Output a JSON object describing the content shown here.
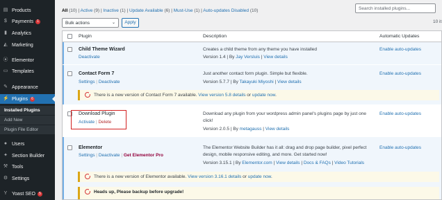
{
  "sidebar": {
    "items": [
      {
        "label": "Products",
        "icon": "products-icon"
      },
      {
        "label": "Payments",
        "icon": "payments-icon",
        "badge": "1"
      },
      {
        "label": "Analytics",
        "icon": "analytics-icon"
      },
      {
        "label": "Marketing",
        "icon": "marketing-icon"
      },
      {
        "label": "Elementor",
        "icon": "elementor-icon"
      },
      {
        "label": "Templates",
        "icon": "templates-icon"
      },
      {
        "label": "Appearance",
        "icon": "appearance-icon"
      },
      {
        "label": "Plugins",
        "icon": "plugins-icon",
        "badge": "6"
      },
      {
        "label": "Users",
        "icon": "users-icon"
      },
      {
        "label": "Section Builder",
        "icon": "section-builder-icon"
      },
      {
        "label": "Tools",
        "icon": "tools-icon"
      },
      {
        "label": "Settings",
        "icon": "settings-icon"
      },
      {
        "label": "Yoast SEO",
        "icon": "yoast-icon",
        "badge": "5"
      }
    ],
    "submenu": [
      "Installed Plugins",
      "Add New",
      "Plugin File Editor"
    ]
  },
  "filters": {
    "all": "All",
    "all_count": "(10)",
    "active": "Active",
    "active_count": "(9)",
    "inactive": "Inactive",
    "inactive_count": "(1)",
    "update": "Update Available",
    "update_count": "(6)",
    "mustuse": "Must-Use",
    "mustuse_count": "(1)",
    "autodisabled": "Auto-updates Disabled",
    "autodisabled_count": "(10)",
    "sep": "|"
  },
  "search": {
    "placeholder": "Search installed plugins..."
  },
  "bulk": {
    "label": "Bulk actions",
    "apply": "Apply"
  },
  "items_count": "10 it",
  "table": {
    "headers": {
      "plugin": "Plugin",
      "description": "Description",
      "auto": "Automatic Updates"
    },
    "rows": [
      {
        "name": "Child Theme Wizard",
        "actions": [
          "Deactivate"
        ],
        "description": "Creates a child theme from any theme you have installed",
        "version": "Version 1.4",
        "by": "By",
        "author": "Jay Versluis",
        "details": "View details",
        "auto": "Enable auto-updates"
      },
      {
        "name": "Contact Form 7",
        "actions": [
          "Settings",
          "Deactivate"
        ],
        "description": "Just another contact form plugin. Simple but flexible.",
        "version": "Version 5.7.7",
        "by": "By",
        "author": "Takayuki Miyoshi",
        "details": "View details",
        "auto": "Enable auto-updates",
        "notice": {
          "pre": "There is a new version of Contact Form 7 available.",
          "link1": "View version 5.8 details",
          "or": "or",
          "link2": "update now",
          "end": "."
        }
      },
      {
        "name": "Download Plugin",
        "actions": [
          "Activate",
          "Delete"
        ],
        "description": "Download any plugin from your wordpress admin panel's plugins page by just one click!",
        "version": "Version 2.0.5",
        "by": "By",
        "author": "metagauss",
        "details": "View details",
        "auto": "Enable auto-updates"
      },
      {
        "name": "Elementor",
        "actions": [
          "Settings",
          "Deactivate",
          "Get Elementor Pro"
        ],
        "description": "The Elementor Website Builder has it all: drag and drop page builder, pixel perfect design, mobile responsive editing, and more. Get started now!",
        "version": "Version 3.15.1",
        "by": "By",
        "author": "Elementor.com",
        "details": "View details",
        "docs": "Docs & FAQs",
        "video": "Video Tutorials",
        "auto": "Enable auto-updates",
        "notice": {
          "pre": "There is a new version of Elementor available.",
          "link1": "View version 3.16.1 details",
          "or": "or",
          "link2": "update now",
          "end": "."
        },
        "notice2": "Heads up, Please backup before upgrade!"
      }
    ]
  }
}
